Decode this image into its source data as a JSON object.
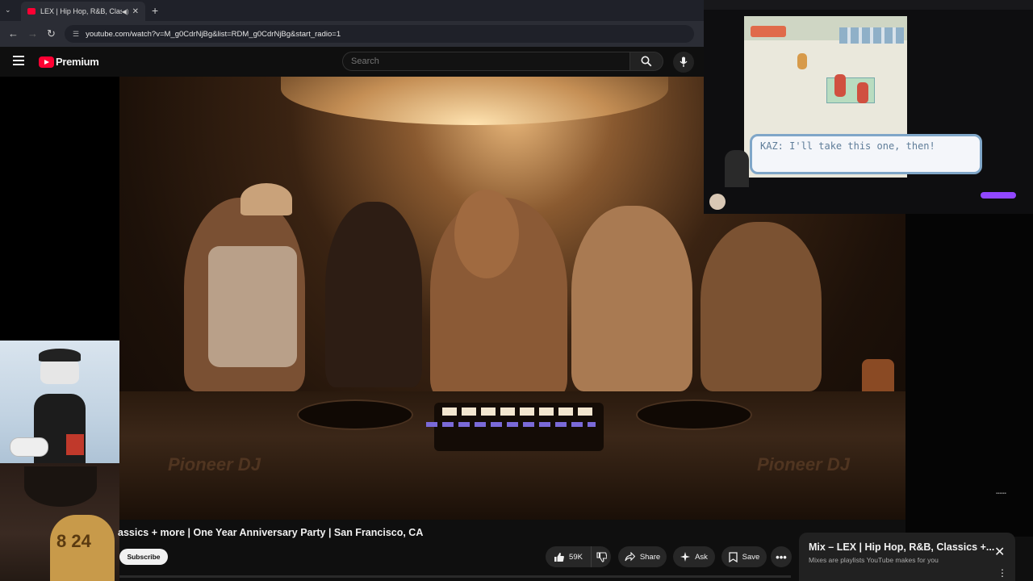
{
  "browser": {
    "tab_title": "LEX | Hip Hop, R&B, Classic",
    "url": "youtube.com/watch?v=M_g0CdrNjBg&list=RDM_g0CdrNjBg&start_radio=1"
  },
  "header": {
    "brand": "Premium",
    "search_placeholder": "Search"
  },
  "video": {
    "title_visible": "assics + more | One Year Anniversary Party | San Francisco, CA",
    "subscribe_label": "Subscribe",
    "like_count": "59K",
    "share_label": "Share",
    "ask_label": "Ask",
    "save_label": "Save",
    "deck_brand": "Pioneer DJ"
  },
  "game_overlay": {
    "dialog_text": "KAZ: I'll take this one, then!"
  },
  "mix_popup": {
    "title": "Mix – LEX | Hip Hop, R&B, Classics +...",
    "subtitle": "Mixes are playlists YouTube makes for you"
  },
  "colors": {
    "youtube_red": "#ff0033",
    "background": "#0f0f0f",
    "dialog_border": "#7fa6c8"
  }
}
